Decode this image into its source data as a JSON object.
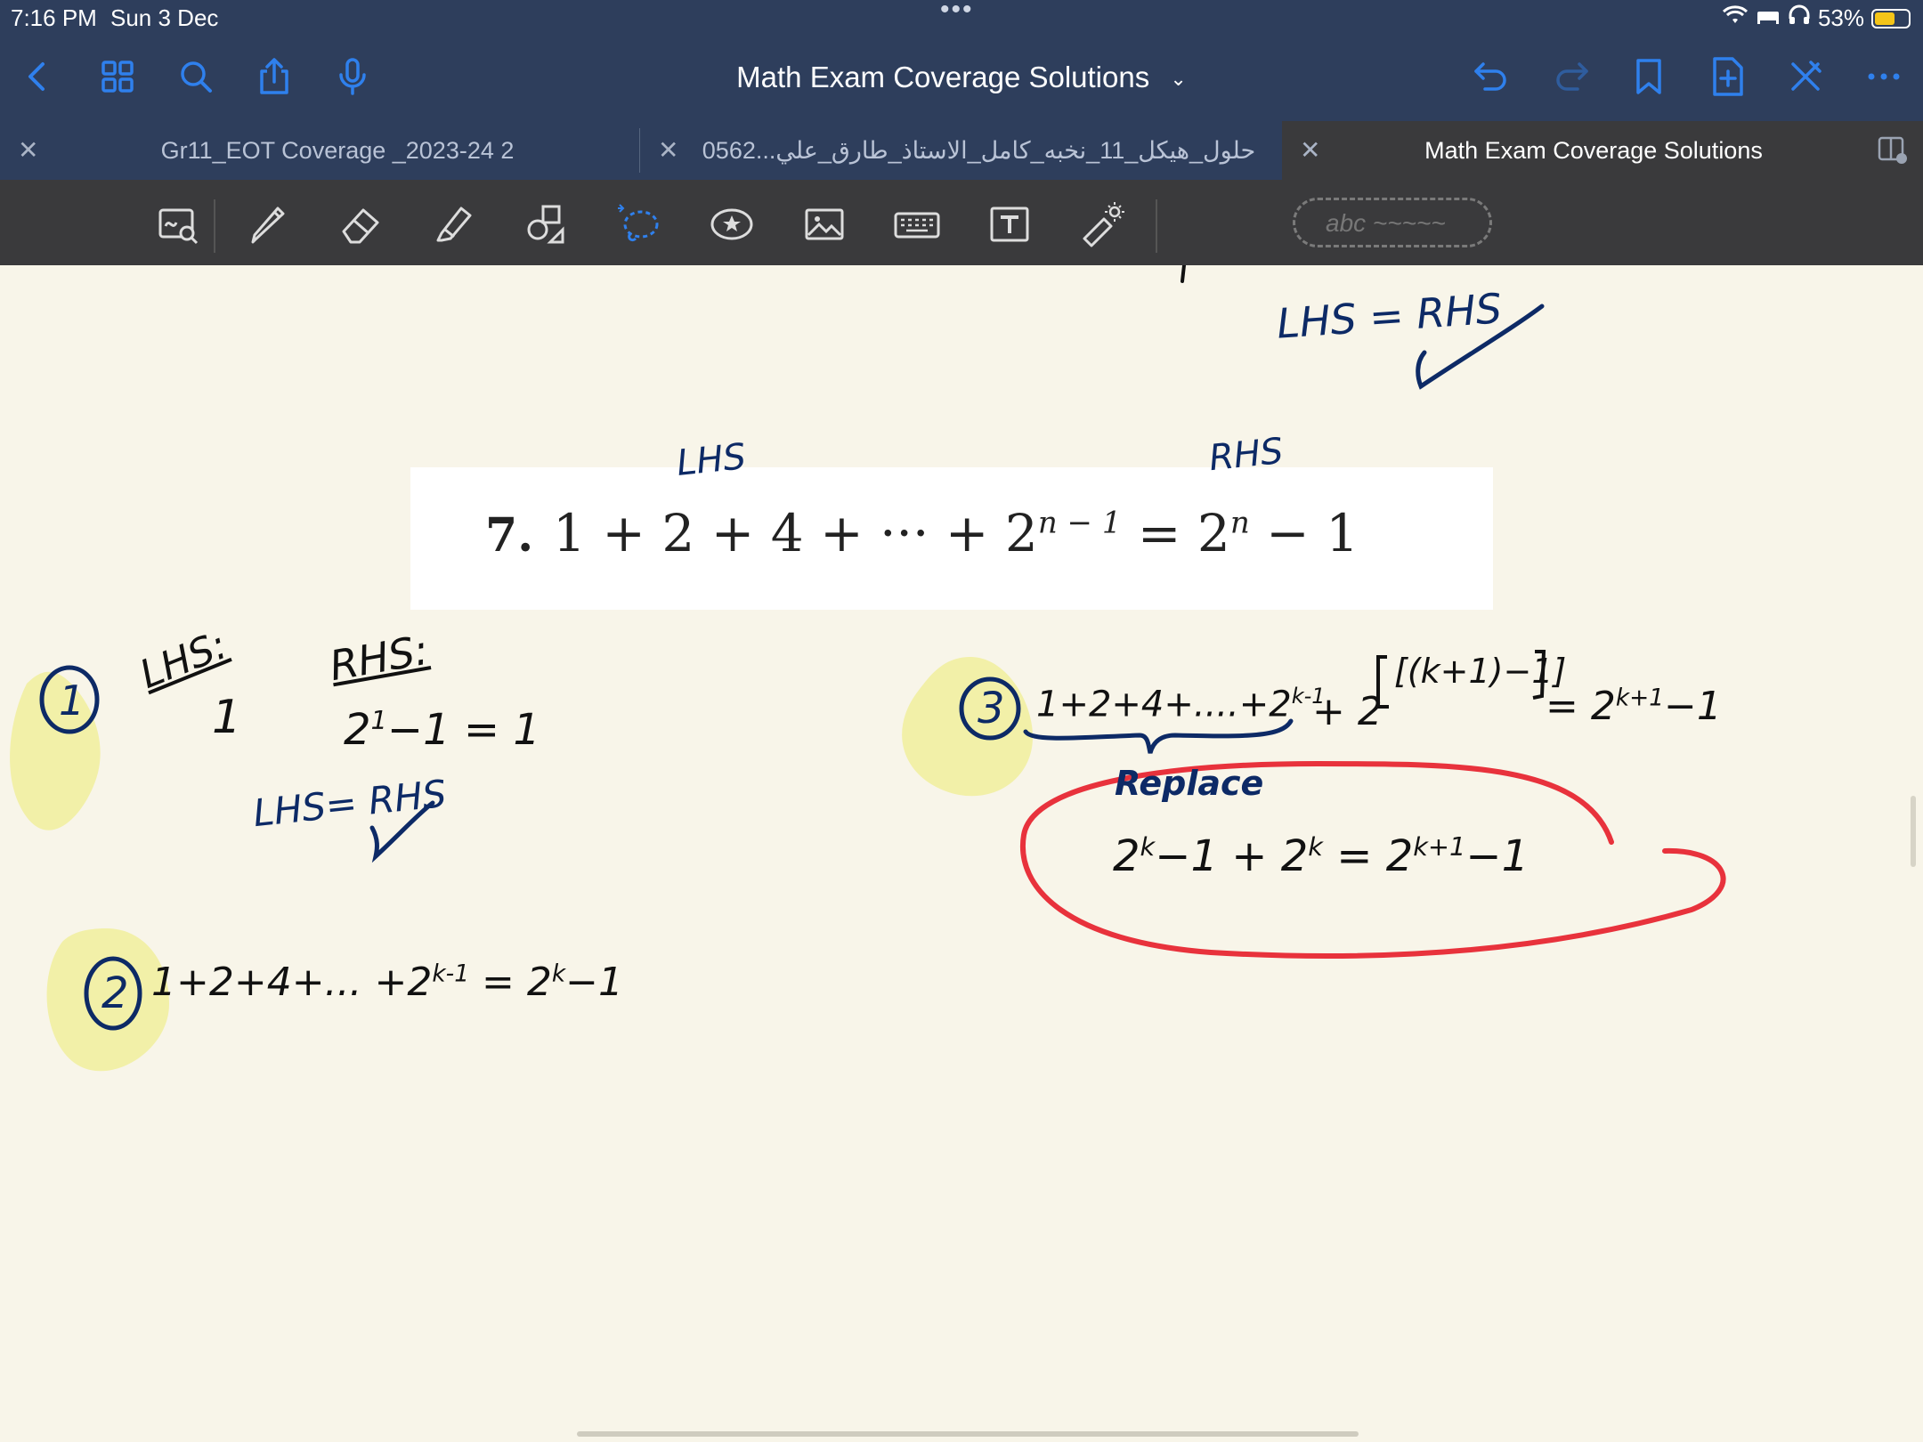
{
  "status": {
    "time": "7:16 PM",
    "date": "Sun 3 Dec",
    "battery": "53%"
  },
  "nav": {
    "title": "Math Exam Coverage Solutions"
  },
  "tabs": [
    {
      "label": "Gr11_EOT Coverage _2023-24 2"
    },
    {
      "label": "حلول_هيكل_11_نخبه_كامل_الاستاذ_طارق_علي...0562"
    },
    {
      "label": "Math Exam Coverage Solutions"
    }
  ],
  "toolbar": {
    "pen_preview": "abc ~~~~~"
  },
  "colors": {
    "statusbar": "#2e3e5c",
    "toolbar": "#3a3a3c",
    "paper": "#f8f5e9",
    "accent_blue": "#2f80ed",
    "ink_navy": "#0d2a66",
    "ink_black": "#111111",
    "ink_red": "#e8323c",
    "highlighter": "#f2f0a8"
  },
  "problem": {
    "number": "7.",
    "lhs": "1 + 2 + 4 + ··· + 2",
    "lhs_exp": "n − 1",
    "mid": " = 2",
    "rhs_exp": "n",
    "rhs_tail": " − 1"
  },
  "handwriting": {
    "top_lhs_rhs": "LHS = RHS",
    "label_lhs": "LHS",
    "label_rhs": "RHS",
    "step1_num": "1",
    "step1_lhs_label": "LHS:",
    "step1_lhs_val": "1",
    "step1_rhs_label": "RHS:",
    "step1_rhs_base": "2",
    "step1_rhs_exp": "1",
    "step1_rhs_tail": "−1 = 1",
    "step1_check": "LHS= RHS",
    "step2_num": "2",
    "step2_expr_a": "1+2+4+... +2",
    "step2_exp1": "k-1",
    "step2_expr_b": "= 2",
    "step2_exp2": "k",
    "step2_expr_c": "−1",
    "step3_num": "3",
    "step3_expr_a": "1+2+4+....+2",
    "step3_exp1": "k-1",
    "step3_plus": "+ 2",
    "step3_bracket": "[(k+1)−1]",
    "step3_rhs": "= 2",
    "step3_rhs_exp": "k+1",
    "step3_rhs_tail": "−1",
    "replace": "Replace",
    "boxed_a": "2",
    "boxed_exp1": "k",
    "boxed_b": "−1 + 2",
    "boxed_exp2": "k",
    "boxed_c": " = 2",
    "boxed_exp3": "k+1",
    "boxed_d": "−1"
  }
}
